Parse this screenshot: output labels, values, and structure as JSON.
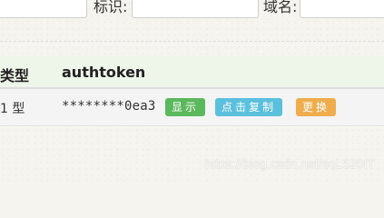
{
  "filters": {
    "field1_value": "",
    "label_identifier": "标识:",
    "field2_value": "",
    "label_domain": "域名:",
    "field3_value": ""
  },
  "table": {
    "headers": {
      "type": "类型",
      "token": "authtoken"
    },
    "rows": [
      {
        "type": "1 型",
        "token": "********0ea3",
        "show_label": "显示",
        "copy_label": "点击复制",
        "swap_label": "更换"
      }
    ]
  },
  "colors": {
    "header_bg": "#eef5e9",
    "show_button": "#5cb85c",
    "copy_button": "#5bc0de",
    "swap_button": "#f0ad4e"
  },
  "watermark": "https://blog.csdn.net/sqL520IT"
}
